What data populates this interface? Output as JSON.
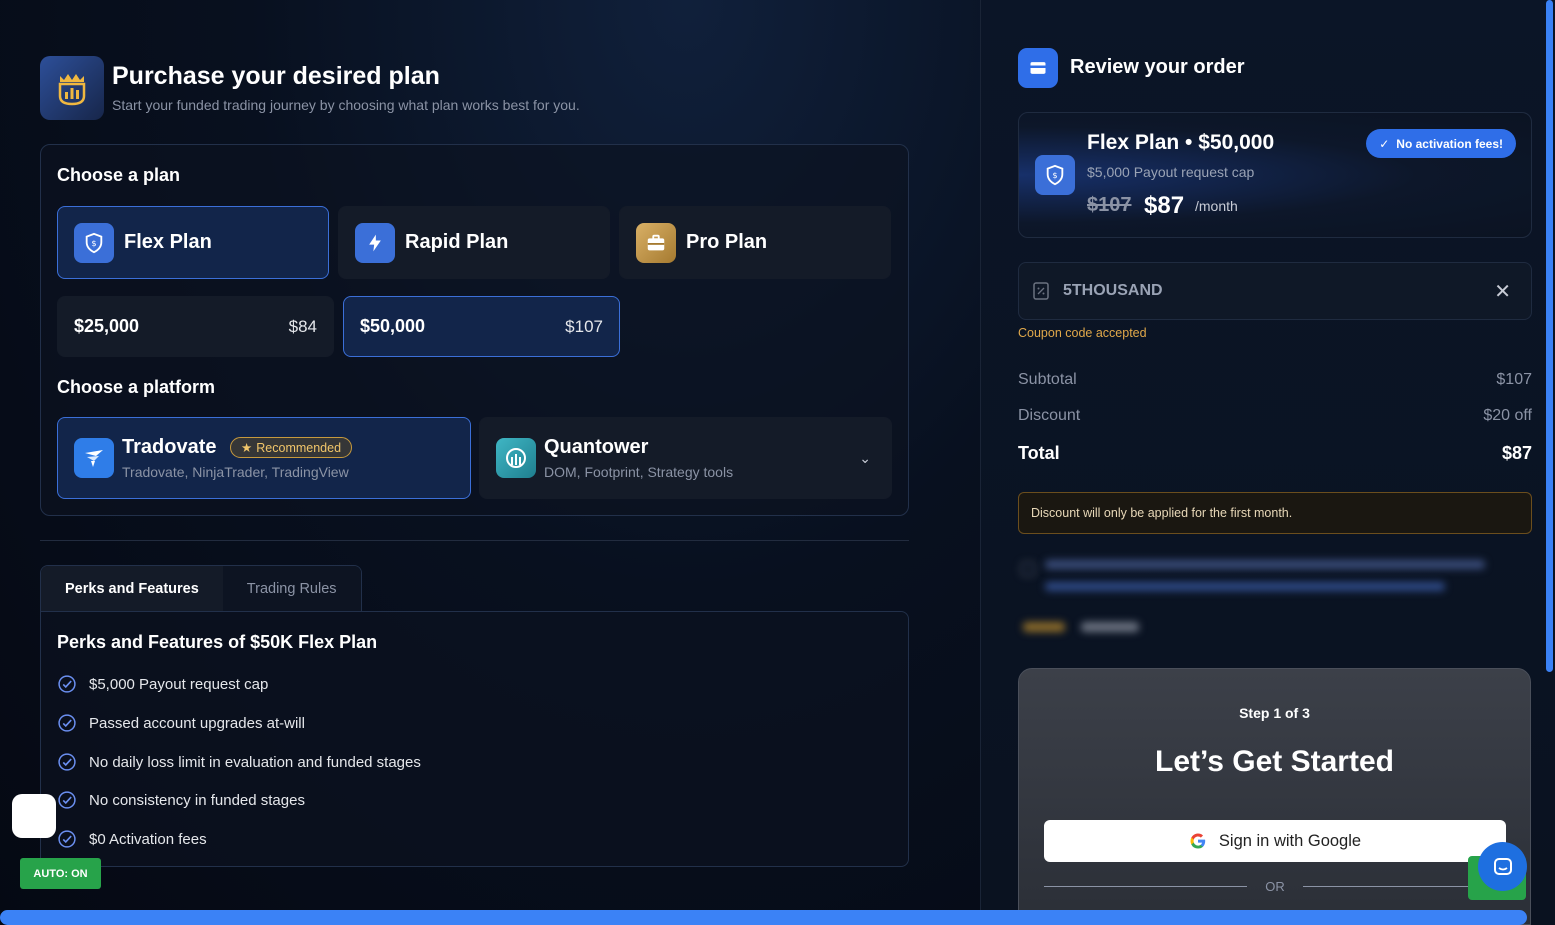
{
  "header": {
    "title": "Purchase your desired plan",
    "subtitle": "Start your funded trading journey by choosing what plan works best for you."
  },
  "plans": {
    "heading": "Choose a plan",
    "items": [
      {
        "label": "Flex Plan",
        "icon": "shield-dollar-icon",
        "selected": true
      },
      {
        "label": "Rapid Plan",
        "icon": "lightning-icon",
        "selected": false
      },
      {
        "label": "Pro Plan",
        "icon": "briefcase-icon",
        "selected": false
      }
    ],
    "sizes": [
      {
        "amount": "$25,000",
        "price": "$84",
        "selected": false
      },
      {
        "amount": "$50,000",
        "price": "$107",
        "selected": true
      }
    ]
  },
  "platforms": {
    "heading": "Choose a platform",
    "items": [
      {
        "name": "Tradovate",
        "badge": "Recommended",
        "sub": "Tradovate, NinjaTrader, TradingView",
        "selected": true
      },
      {
        "name": "Quantower",
        "sub": "DOM, Footprint, Strategy tools",
        "selected": false
      }
    ]
  },
  "tabs": [
    {
      "label": "Perks and Features",
      "active": true
    },
    {
      "label": "Trading Rules",
      "active": false
    }
  ],
  "perks": {
    "title": "Perks and Features of $50K Flex Plan",
    "items": [
      "$5,000 Payout request cap",
      "Passed account upgrades at-will",
      "No daily loss limit in evaluation and funded stages",
      "No consistency in funded stages",
      "$0 Activation fees"
    ]
  },
  "auto_badge": "AUTO: ON",
  "review": {
    "title": "Review your order",
    "plan_name": "Flex Plan • $50,000",
    "plan_cap": "$5,000 Payout request cap",
    "old_price": "$107",
    "new_price": "$87",
    "per": "/month",
    "no_activation": "No activation fees!",
    "coupon_code": "5THOUSAND",
    "coupon_status": "Coupon code accepted",
    "subtotal_label": "Subtotal",
    "subtotal_value": "$107",
    "discount_label": "Discount",
    "discount_value": "$20 off",
    "total_label": "Total",
    "total_value": "$87",
    "notice": "Discount will only be applied for the first month."
  },
  "signin": {
    "step": "Step 1 of 3",
    "title": "Let’s Get Started",
    "google_label": "Sign in with Google",
    "or": "OR"
  },
  "colors": {
    "accent": "#3b82f6",
    "coupon_ok": "#e0a84a",
    "auto_green": "#27a34a"
  }
}
